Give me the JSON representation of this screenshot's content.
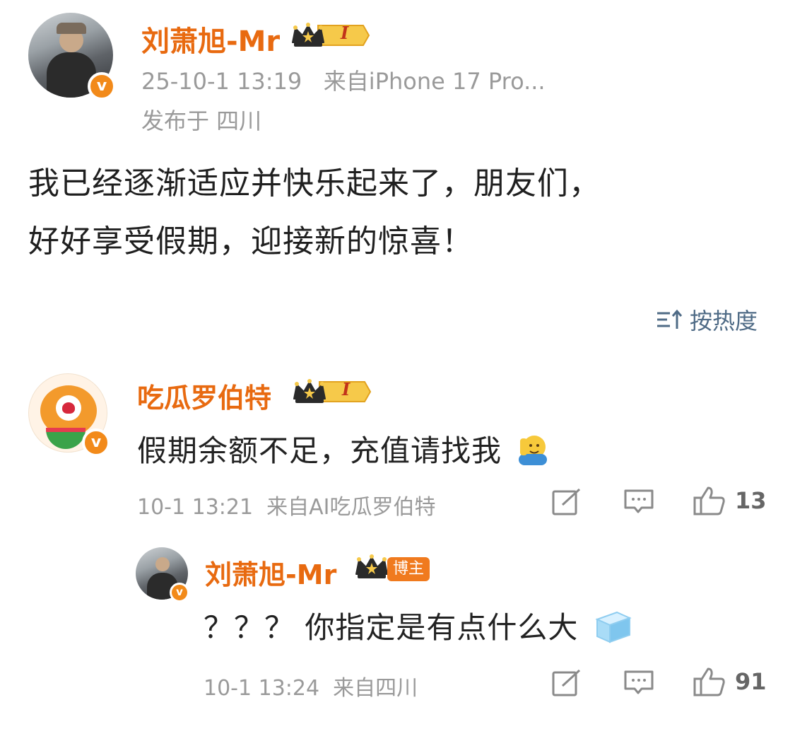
{
  "post": {
    "author": "刘萧旭-Mr",
    "rank_badge": "I",
    "time": "25-10-1 13:19",
    "source": "来自iPhone 17 Pro...",
    "location": "发布于 四川",
    "text_line1": "我已经逐渐适应并快乐起来了，朋友们，",
    "text_line2": "好好享受假期，迎接新的惊喜！"
  },
  "sort": {
    "label": "按热度",
    "icon": "sort-icon"
  },
  "comments": [
    {
      "author": "吃瓜罗伯特",
      "rank_badge": "I",
      "text": "假期余额不足，充值请找我",
      "emoji": "salute-emoji",
      "time": "10-1 13:21",
      "source": "来自AI吃瓜罗伯特",
      "likes": "13"
    }
  ],
  "reply": {
    "author": "刘萧旭-Mr",
    "blogger_label": "博主",
    "text": "？？？ 你指定是有点什么大",
    "emoji": "ice-cube-emoji",
    "time": "10-1 13:24",
    "source": "来自四川",
    "likes": "91"
  },
  "colors": {
    "username": "#e86a10",
    "meta": "#9a9a9a",
    "sort": "#4f6b86",
    "verified": "#f28a1a"
  }
}
